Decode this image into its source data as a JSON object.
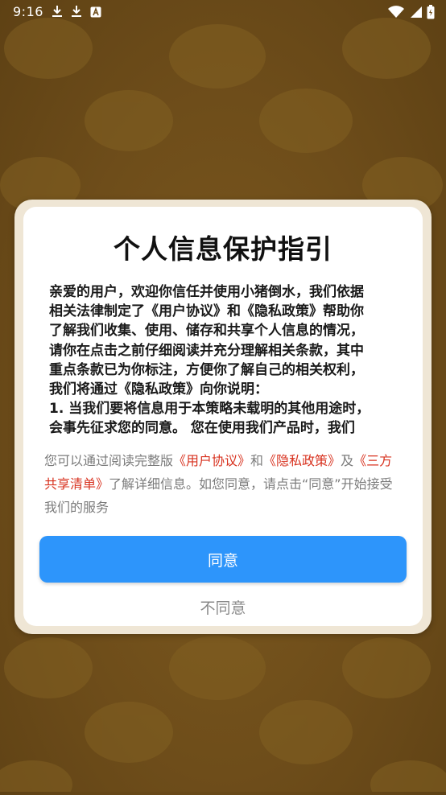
{
  "status_bar": {
    "time": "9:16",
    "left_icons": [
      "download-icon",
      "download-icon",
      "app-notification-icon"
    ],
    "right_icons": [
      "wifi-icon",
      "cellular-signal-icon",
      "battery-icon"
    ]
  },
  "dialog": {
    "title": "个人信息保护指引",
    "body": "亲爱的用户，欢迎你信任并使用小猪倒水，我们依据相关法律制定了《用户协议》和《隐私政策》帮助你了解我们收集、使用、储存和共享个人信息的情况，请你在点击之前仔细阅读并充分理解相关条款，其中重点条款已为你标注，方便你了解自己的相关权利，我们将通过《隐私政策》向你说明：1. 当我们要将信息用于本策略未载明的其他用途时，会事先征求您的同意。 您在使用我们产品时，我们",
    "body_lines": [
      "亲爱的用户，欢迎你信任并使用小猪倒水，我们依据",
      "相关法律制定了《用户协议》和《隐私政策》帮助你",
      "了解我们收集、使用、储存和共享个人信息的情况，",
      "请你在点击之前仔细阅读并充分理解相关条款，其中",
      "重点条款已为你标注，方便你了解自己的相关权利，",
      "我们将通过《隐私政策》向你说明：",
      "1. 当我们要将信息用于本策略未载明的其他用途时，",
      "会事先征求您的同意。 您在使用我们产品时，我们"
    ],
    "footnote": {
      "prefix": "您可以通过阅读完整版",
      "link_user_agreement": "《用户协议》",
      "and": "和",
      "link_privacy_policy": "《隐私政策》",
      "and2": "及",
      "link_third_party_list": "《三方共享清单》",
      "suffix": "了解详细信息。如您同意，请点击“同意”开始接受我们的服务"
    },
    "agree_label": "同意",
    "disagree_label": "不同意"
  },
  "colors": {
    "background": "#6e4d1a",
    "dialog_frame": "#efe6d5",
    "agree_button": "#2d95fb",
    "link": "#d8321f",
    "footnote_text": "#7b7b7b"
  }
}
